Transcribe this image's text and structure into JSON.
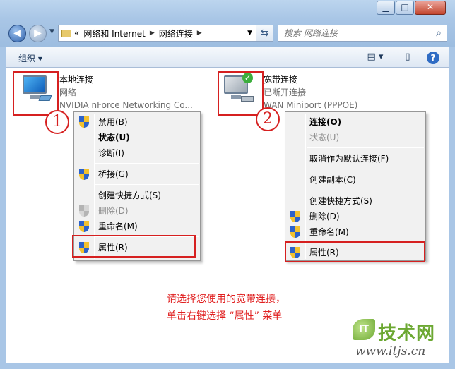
{
  "window": {
    "min_label": "▁",
    "max_label": "□",
    "close_label": "✕"
  },
  "nav": {
    "back_icon": "back-arrow-icon",
    "forward_icon": "forward-arrow-icon"
  },
  "address": {
    "overflow": "«",
    "segments": [
      "网络和 Internet",
      "网络连接"
    ]
  },
  "search": {
    "placeholder": "搜索 网络连接"
  },
  "toolbar": {
    "organize_label": "组织 ▾",
    "help_label": "?"
  },
  "connections": [
    {
      "name": "本地连接",
      "status": "网络",
      "device": "NVIDIA nForce Networking Co..."
    },
    {
      "name": "宽带连接",
      "status": "已断开连接",
      "device": "WAN Miniport (PPPOE)"
    }
  ],
  "annotations": {
    "num1": "1",
    "num2": "2",
    "hint_line1": "请选择您使用的宽带连接，",
    "hint_line2": "单击右键选择 “属性” 菜单"
  },
  "menu1": {
    "items": [
      {
        "label": "禁用(B)"
      },
      {
        "label": "状态(U)"
      },
      {
        "label": "诊断(I)"
      },
      {
        "label": "桥接(G)"
      },
      {
        "label": "创建快捷方式(S)"
      },
      {
        "label": "删除(D)"
      },
      {
        "label": "重命名(M)"
      },
      {
        "label": "属性(R)"
      }
    ]
  },
  "menu2": {
    "items": [
      {
        "label": "连接(O)"
      },
      {
        "label": "状态(U)"
      },
      {
        "label": "取消作为默认连接(F)"
      },
      {
        "label": "创建副本(C)"
      },
      {
        "label": "创建快捷方式(S)"
      },
      {
        "label": "删除(D)"
      },
      {
        "label": "重命名(M)"
      },
      {
        "label": "属性(R)"
      }
    ]
  },
  "watermark": {
    "badge": "IT",
    "brand": "技术网",
    "url": "www.itjs.cn"
  },
  "colors": {
    "highlight_red": "#d62020",
    "hint_red": "#e02020",
    "chrome_blue": "#a9c6e6"
  }
}
